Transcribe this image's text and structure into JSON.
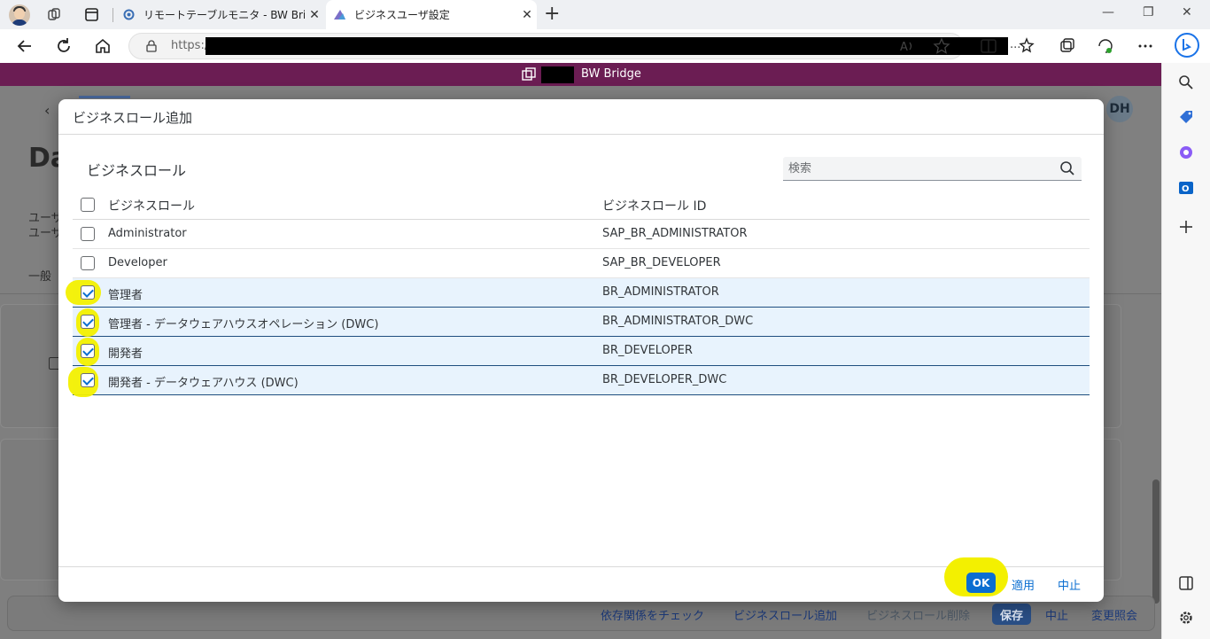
{
  "browser": {
    "tabs": [
      {
        "title": "リモートテーブルモニタ - BW Bridge (S",
        "close": "✕"
      },
      {
        "title": "ビジネスユーザ設定",
        "close": "✕"
      }
    ],
    "new_tab": "+",
    "url_prefix": "https:/",
    "url_ellipsis": "..."
  },
  "shell": {
    "title": "BW Bridge",
    "color": "#6b1d53"
  },
  "background": {
    "avatar": "DH",
    "page_title_partial": "Da",
    "text_line1": "ユーザ",
    "text_line2": "ユーザ",
    "tab_general": "一般"
  },
  "footer": {
    "check_dependencies": "依存関係をチェック",
    "add_business_role": "ビジネスロール追加",
    "delete_business_role": "ビジネスロール削除",
    "save": "保存",
    "cancel": "中止",
    "change_documents": "変更照会"
  },
  "dialog": {
    "title": "ビジネスロール追加",
    "section_title": "ビジネスロール",
    "search_placeholder": "検索",
    "columns": {
      "role": "ビジネスロール",
      "role_id": "ビジネスロール ID"
    },
    "rows": [
      {
        "role": "Administrator",
        "role_id": "SAP_BR_ADMINISTRATOR",
        "checked": false
      },
      {
        "role": "Developer",
        "role_id": "SAP_BR_DEVELOPER",
        "checked": false
      },
      {
        "role": "管理者",
        "role_id": "BR_ADMINISTRATOR",
        "checked": true
      },
      {
        "role": "管理者 - データウェアハウスオペレーション (DWC)",
        "role_id": "BR_ADMINISTRATOR_DWC",
        "checked": true
      },
      {
        "role": "開発者",
        "role_id": "BR_DEVELOPER",
        "checked": true
      },
      {
        "role": "開発者 - データウェアハウス (DWC)",
        "role_id": "BR_DEVELOPER_DWC",
        "checked": true
      }
    ],
    "buttons": {
      "ok": "OK",
      "apply": "適用",
      "cancel": "中止"
    }
  },
  "colors": {
    "accent": "#0a6ed1",
    "highlight": "#f3f000",
    "selected_row": "#e8f3fd"
  }
}
